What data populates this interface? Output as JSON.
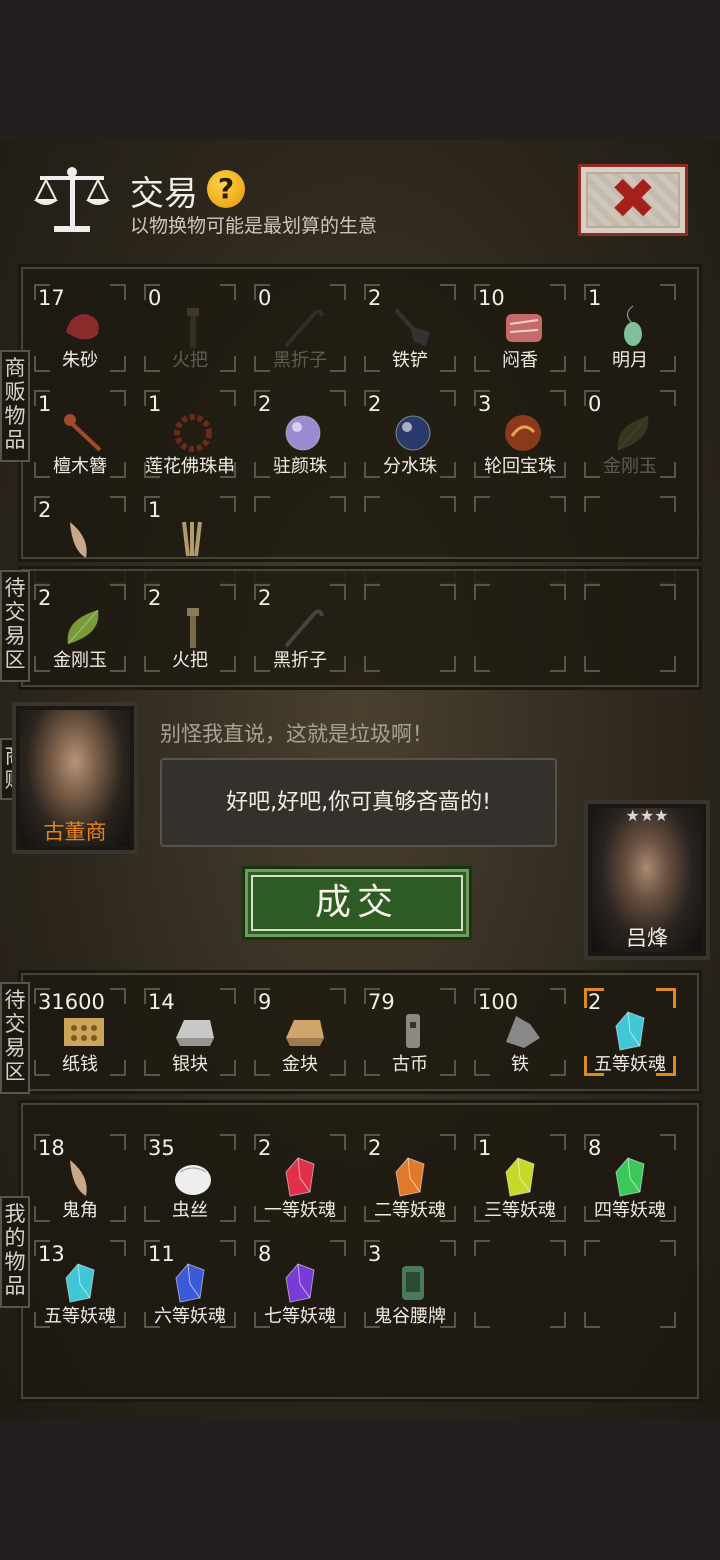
{
  "header": {
    "title": "交易",
    "help_glyph": "?",
    "subtitle": "以物换物可能是最划算的生意"
  },
  "labels": {
    "merchant_goods": "商贩物品",
    "merchant_pending": "待交易区",
    "merchant": "商贩",
    "my_pending": "待交易区",
    "my_goods": "我的物品"
  },
  "merchant_goods": [
    {
      "count": "17",
      "name": "朱砂",
      "icon": "cinnabar",
      "color": "#8a2a2a"
    },
    {
      "count": "0",
      "name": "火把",
      "icon": "torch",
      "color": "#6b5a3a",
      "dim": true
    },
    {
      "count": "0",
      "name": "黑折子",
      "icon": "hook",
      "color": "#555",
      "dim": true
    },
    {
      "count": "2",
      "name": "铁铲",
      "icon": "shovel",
      "color": "#333"
    },
    {
      "count": "10",
      "name": "闷香",
      "icon": "incense",
      "color": "#c56a6a"
    },
    {
      "count": "1",
      "name": "明月",
      "icon": "pendant",
      "color": "#7fbf9a"
    },
    {
      "count": "1",
      "name": "檀木簪",
      "icon": "hairpin",
      "color": "#a04a2a"
    },
    {
      "count": "1",
      "name": "莲花佛珠串",
      "icon": "beads",
      "color": "#6a2a1a"
    },
    {
      "count": "2",
      "name": "驻颜珠",
      "icon": "pearl",
      "color": "#9a8ad0"
    },
    {
      "count": "2",
      "name": "分水珠",
      "icon": "pearl",
      "color": "#2a3a6a"
    },
    {
      "count": "3",
      "name": "轮回宝珠",
      "icon": "orb",
      "color": "#8a3a1a"
    },
    {
      "count": "0",
      "name": "金刚玉",
      "icon": "leafgem",
      "color": "#6a7a3a",
      "dim": true
    },
    {
      "count": "2",
      "name": "",
      "icon": "horn",
      "color": "#c9a88a"
    },
    {
      "count": "1",
      "name": "",
      "icon": "rope",
      "color": "#b39a6a"
    }
  ],
  "merchant_pending": [
    {
      "count": "2",
      "name": "金刚玉",
      "icon": "leafgem",
      "color": "#7a9a3a"
    },
    {
      "count": "2",
      "name": "火把",
      "icon": "torch",
      "color": "#7a6a4a"
    },
    {
      "count": "2",
      "name": "黑折子",
      "icon": "hook",
      "color": "#444"
    }
  ],
  "merchant_npc": {
    "name": "古董商",
    "line": "别怪我直说，这就是垃圾啊！"
  },
  "player": {
    "name": "吕烽",
    "stars": "★★★",
    "reply": "好吧,好吧,你可真够吝啬的!"
  },
  "deal_button": "成交",
  "my_pending": [
    {
      "count": "31600",
      "name": "纸钱",
      "icon": "paper",
      "color": "#c9a65a"
    },
    {
      "count": "14",
      "name": "银块",
      "icon": "ingot",
      "color": "#c8c8c8"
    },
    {
      "count": "9",
      "name": "金块",
      "icon": "ingot",
      "color": "#d2a36a"
    },
    {
      "count": "79",
      "name": "古币",
      "icon": "coin",
      "color": "#8a8a80"
    },
    {
      "count": "100",
      "name": "铁",
      "icon": "ore",
      "color": "#888"
    },
    {
      "count": "2",
      "name": "五等妖魂",
      "icon": "crystal",
      "color": "#3fc7d6",
      "selected": true
    }
  ],
  "my_goods": [
    {
      "count": "18",
      "name": "鬼角",
      "icon": "horn",
      "color": "#c9a88a"
    },
    {
      "count": "35",
      "name": "虫丝",
      "icon": "silk",
      "color": "#eeeeee"
    },
    {
      "count": "2",
      "name": "一等妖魂",
      "icon": "crystal",
      "color": "#e0304a"
    },
    {
      "count": "2",
      "name": "二等妖魂",
      "icon": "crystal",
      "color": "#e07a2a"
    },
    {
      "count": "1",
      "name": "三等妖魂",
      "icon": "crystal",
      "color": "#c8d82a"
    },
    {
      "count": "8",
      "name": "四等妖魂",
      "icon": "crystal",
      "color": "#3ac85a"
    },
    {
      "count": "13",
      "name": "五等妖魂",
      "icon": "crystal",
      "color": "#3fc7d6"
    },
    {
      "count": "11",
      "name": "六等妖魂",
      "icon": "crystal",
      "color": "#3a5ad8"
    },
    {
      "count": "8",
      "name": "七等妖魂",
      "icon": "crystal",
      "color": "#7a3ad8"
    },
    {
      "count": "3",
      "name": "鬼谷腰牌",
      "icon": "token",
      "color": "#4a7a5a"
    }
  ]
}
